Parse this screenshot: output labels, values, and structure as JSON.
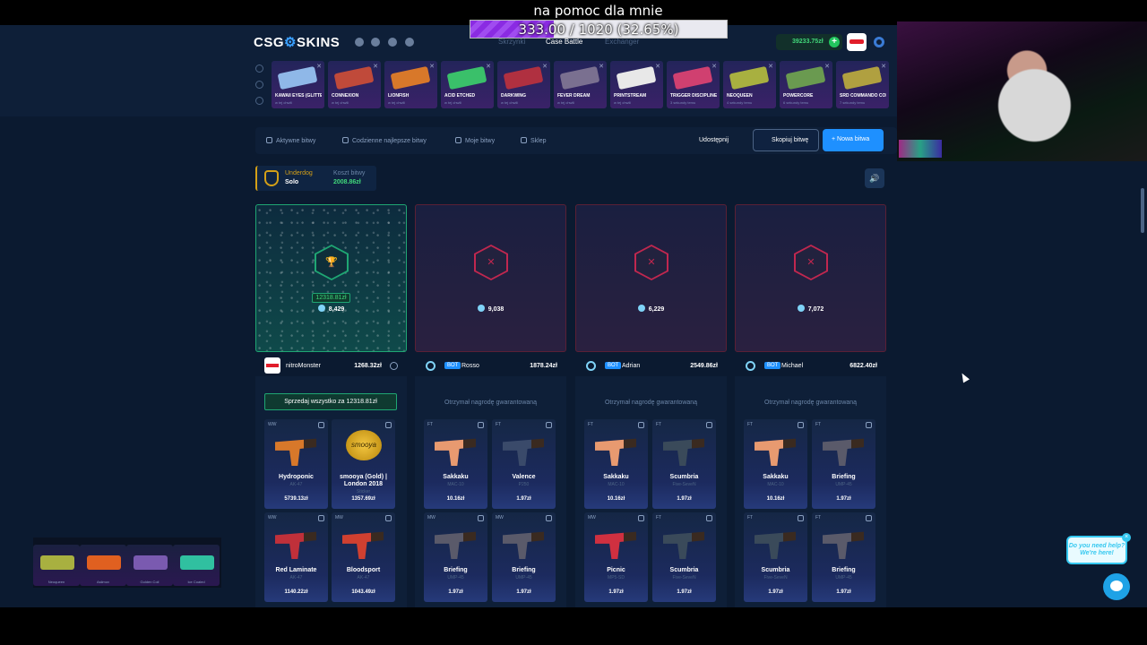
{
  "stream": {
    "title": "na pomoc dla mnie",
    "goal_text": "333.00 / 1020 (32.65%)",
    "goal_progress": 0.3265
  },
  "site": {
    "logo_left": "CSG",
    "logo_right": "SKINS",
    "nav": [
      "Skrzynki",
      "Case Battle",
      "Exchanger"
    ],
    "balance": "39233.75zł",
    "balance_plus": "+"
  },
  "drops": [
    {
      "name": "Kawaii Eyes (Glitter)",
      "sub": "w tej chwili",
      "color": "#8fb8e8"
    },
    {
      "name": "Connexion",
      "sub": "w tej chwili",
      "color": "#c04a3a"
    },
    {
      "name": "Lionfish",
      "sub": "w tej chwili",
      "color": "#d8782a"
    },
    {
      "name": "Acid Etched",
      "sub": "w tej chwili",
      "color": "#3ac06a"
    },
    {
      "name": "Darkwing",
      "sub": "w tej chwili",
      "color": "#b03040"
    },
    {
      "name": "Fever Dream",
      "sub": "w tej chwili",
      "color": "#7a7090"
    },
    {
      "name": "Printstream",
      "sub": "w tej chwili",
      "color": "#e8e8e8"
    },
    {
      "name": "Trigger Discipline",
      "sub": "3 sekundy temu",
      "color": "#d04070"
    },
    {
      "name": "Neoqueen",
      "sub": "4 sekundy temu",
      "color": "#a8b040"
    },
    {
      "name": "Powercore",
      "sub": "6 sekundy temu",
      "color": "#6a9a50"
    },
    {
      "name": "SRD Commando Company",
      "sub": "7 sekundy temu",
      "color": "#b0a040"
    }
  ],
  "tabs": {
    "active": "Aktywne bitwy",
    "daily": "Codzienne najlepsze bitwy",
    "mine": "Moje bitwy",
    "shop": "Sklep",
    "share": "Udostępnij",
    "copy": "Skopiuj bitwę",
    "new": "+ Nowa bitwa"
  },
  "battle": {
    "mode_label": "Underdog",
    "mode_value": "Solo",
    "cost_label": "Koszt bitwy",
    "cost_value": "2008.86zł",
    "sound_icon": "🔊"
  },
  "players": [
    {
      "name": "nitroMonster",
      "value": "1268.32zł",
      "tickets": "8,429",
      "prize": "12318.81zł",
      "bot": false,
      "winner": true
    },
    {
      "name": "Rosso",
      "value": "1878.24zł",
      "tickets": "9,038",
      "bot": true,
      "winner": false
    },
    {
      "name": "Adrian",
      "value": "2549.86zł",
      "tickets": "6,229",
      "bot": true,
      "winner": false
    },
    {
      "name": "Michael",
      "value": "6822.40zł",
      "tickets": "7,072",
      "bot": true,
      "winner": false
    }
  ],
  "bot_label": "BOT",
  "sell_all": "Sprzedaj wszystko za 12318.81zł",
  "guaranteed": "Otrzymał nagrodę gwarantowaną",
  "items": [
    [
      {
        "wear": "WW",
        "name": "Hydroponic",
        "type": "AK-47",
        "price": "5739.13zł",
        "color": "#d8782a"
      },
      {
        "wear": "",
        "name": "smooya (Gold) | London 2018",
        "type": "Sticker",
        "price": "1357.69zł",
        "color": "#e0b020",
        "sticker": true
      },
      {
        "wear": "WW",
        "name": "Red Laminate",
        "type": "AK-47",
        "price": "1140.22zł",
        "color": "#c0303a"
      },
      {
        "wear": "MW",
        "name": "Bloodsport",
        "type": "AK-47",
        "price": "1043.49zł",
        "color": "#d04030"
      }
    ],
    [
      {
        "wear": "FT",
        "name": "Sakkaku",
        "type": "MAC-10",
        "price": "10.16zł",
        "color": "#e89a70"
      },
      {
        "wear": "FT",
        "name": "Valence",
        "type": "P250",
        "price": "1.97zł",
        "color": "#3a4a6a"
      },
      {
        "wear": "MW",
        "name": "Briefing",
        "type": "UMP-45",
        "price": "1.97zł",
        "color": "#5a5a6a"
      },
      {
        "wear": "MW",
        "name": "Briefing",
        "type": "UMP-45",
        "price": "1.97zł",
        "color": "#5a5a6a"
      }
    ],
    [
      {
        "wear": "FT",
        "name": "Sakkaku",
        "type": "MAC-10",
        "price": "10.16zł",
        "color": "#e89a70"
      },
      {
        "wear": "FT",
        "name": "Scumbria",
        "type": "Five-SeveN",
        "price": "1.97zł",
        "color": "#3a4a5a"
      },
      {
        "wear": "MW",
        "name": "Picnic",
        "type": "MP5-SD",
        "price": "1.97zł",
        "color": "#d03040"
      },
      {
        "wear": "FT",
        "name": "Scumbria",
        "type": "Five-SeveN",
        "price": "1.97zł",
        "color": "#3a4a5a"
      }
    ],
    [
      {
        "wear": "FT",
        "name": "Sakkaku",
        "type": "MAC-10",
        "price": "10.16zł",
        "color": "#e89a70"
      },
      {
        "wear": "FT",
        "name": "Briefing",
        "type": "UMP-45",
        "price": "1.97zł",
        "color": "#5a5a6a"
      },
      {
        "wear": "FT",
        "name": "Scumbria",
        "type": "Five-SeveN",
        "price": "1.97zł",
        "color": "#3a4a5a"
      },
      {
        "wear": "FT",
        "name": "Briefing",
        "type": "UMP-45",
        "price": "1.97zł",
        "color": "#5a5a6a"
      }
    ]
  ],
  "mini_overlay": [
    {
      "name": "Neoqueen",
      "color": "#a8b040"
    },
    {
      "name": "Asiimov",
      "color": "#e06020"
    },
    {
      "name": "Golden Coil",
      "color": "#7a5ab0"
    },
    {
      "name": "Ice Coaled",
      "color": "#30c0a0"
    }
  ],
  "help": {
    "text": "Do you need help? We're here!",
    "close": "×"
  }
}
